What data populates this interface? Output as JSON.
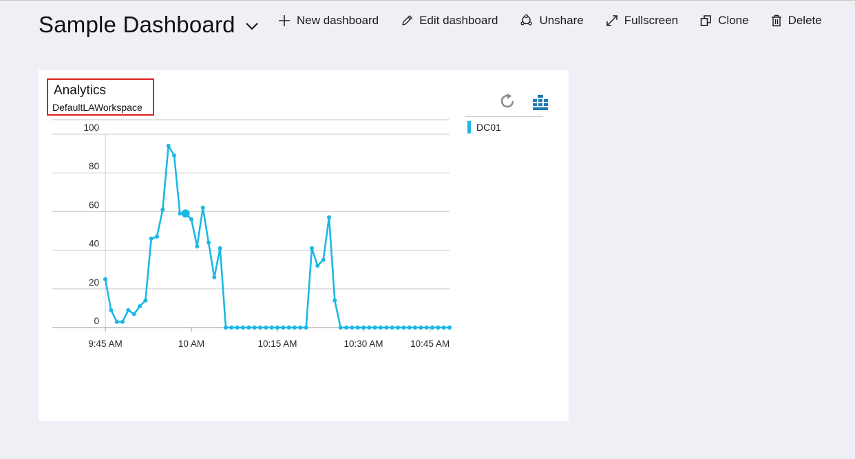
{
  "dashboard": {
    "title": "Sample Dashboard"
  },
  "toolbar": {
    "new_dashboard": "New dashboard",
    "edit_dashboard": "Edit dashboard",
    "unshare": "Unshare",
    "fullscreen": "Fullscreen",
    "clone": "Clone",
    "delete": "Delete"
  },
  "tile": {
    "title": "Analytics",
    "subtitle": "DefaultLAWorkspace",
    "legend": [
      {
        "name": "DC01",
        "color": "#1ab8e5"
      }
    ]
  },
  "icons": [
    "chevron-down-icon",
    "plus-icon",
    "pencil-icon",
    "unshare-icon",
    "fullscreen-icon",
    "clone-icon",
    "trash-icon",
    "refresh-icon",
    "grid-icon"
  ],
  "chart_data": {
    "type": "line",
    "title": "",
    "xlabel": "",
    "ylabel": "",
    "ylim": [
      0,
      100
    ],
    "yticks": [
      0,
      20,
      40,
      60,
      80,
      100
    ],
    "x_tick_labels": [
      "9:45 AM",
      "10 AM",
      "10:15 AM",
      "10:30 AM",
      "10:45 AM"
    ],
    "x_tick_minutes": [
      0,
      15,
      30,
      45,
      56.6
    ],
    "x_range_minutes": [
      0,
      60
    ],
    "grid": true,
    "legend_position": "right",
    "series": [
      {
        "name": "DC01",
        "color": "#1ab8e5",
        "points": [
          [
            0,
            25
          ],
          [
            1,
            9
          ],
          [
            2,
            3
          ],
          [
            3,
            3
          ],
          [
            4,
            9
          ],
          [
            5,
            7
          ],
          [
            6,
            11
          ],
          [
            7,
            14
          ],
          [
            8,
            46
          ],
          [
            9,
            47
          ],
          [
            10,
            61
          ],
          [
            11,
            94
          ],
          [
            12,
            89
          ],
          [
            13,
            59
          ],
          [
            14,
            59
          ],
          [
            15,
            56
          ],
          [
            16,
            42
          ],
          [
            17,
            62
          ],
          [
            18,
            44
          ],
          [
            19,
            26
          ],
          [
            20,
            41
          ],
          [
            21,
            0
          ],
          [
            22,
            0
          ],
          [
            23,
            0
          ],
          [
            24,
            0
          ],
          [
            25,
            0
          ],
          [
            26,
            0
          ],
          [
            27,
            0
          ],
          [
            28,
            0
          ],
          [
            29,
            0
          ],
          [
            30,
            0
          ],
          [
            31,
            0
          ],
          [
            32,
            0
          ],
          [
            33,
            0
          ],
          [
            34,
            0
          ],
          [
            35,
            0
          ],
          [
            36,
            41
          ],
          [
            37,
            32
          ],
          [
            38,
            35
          ],
          [
            39,
            57
          ],
          [
            40,
            14
          ],
          [
            41,
            0
          ],
          [
            42,
            0
          ],
          [
            43,
            0
          ],
          [
            44,
            0
          ],
          [
            45,
            0
          ],
          [
            46,
            0
          ],
          [
            47,
            0
          ],
          [
            48,
            0
          ],
          [
            49,
            0
          ],
          [
            50,
            0
          ],
          [
            51,
            0
          ],
          [
            52,
            0
          ],
          [
            53,
            0
          ],
          [
            54,
            0
          ],
          [
            55,
            0
          ],
          [
            56,
            0
          ],
          [
            57,
            0
          ],
          [
            58,
            0
          ],
          [
            59,
            0
          ],
          [
            60,
            0
          ]
        ],
        "highlight_minute": 14
      }
    ]
  }
}
